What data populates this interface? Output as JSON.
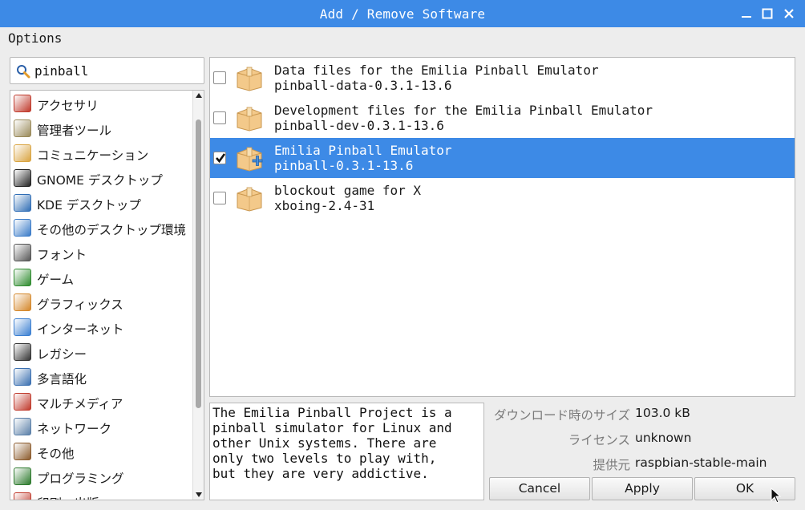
{
  "window": {
    "title": "Add / Remove Software"
  },
  "menu": {
    "options_label": "Options"
  },
  "search": {
    "value": "pinball"
  },
  "categories": [
    {
      "label": "アクセサリ",
      "icon": "accessories-icon",
      "color": "#c0392b"
    },
    {
      "label": "管理者ツール",
      "icon": "admin-tools-icon",
      "color": "#9a8a5a"
    },
    {
      "label": "コミュニケーション",
      "icon": "communication-icon",
      "color": "#d9a441"
    },
    {
      "label": "GNOME デスクトップ",
      "icon": "gnome-foot-icon",
      "color": "#222222"
    },
    {
      "label": "KDE デスクトップ",
      "icon": "kde-icon",
      "color": "#2f6db5"
    },
    {
      "label": "その他のデスクトップ環境",
      "icon": "desktop-icon",
      "color": "#3a7bc8"
    },
    {
      "label": "フォント",
      "icon": "font-icon",
      "color": "#555555"
    },
    {
      "label": "ゲーム",
      "icon": "game-invader-icon",
      "color": "#2e8b2e"
    },
    {
      "label": "グラフィックス",
      "icon": "graphics-brush-icon",
      "color": "#d4872a"
    },
    {
      "label": "インターネット",
      "icon": "globe-icon",
      "color": "#3b7fd1"
    },
    {
      "label": "レガシー",
      "icon": "floppy-icon",
      "color": "#333333"
    },
    {
      "label": "多言語化",
      "icon": "language-icon",
      "color": "#3a6fb0"
    },
    {
      "label": "マルチメディア",
      "icon": "multimedia-icon",
      "color": "#c0392b"
    },
    {
      "label": "ネットワーク",
      "icon": "network-icon",
      "color": "#5a7fa8"
    },
    {
      "label": "その他",
      "icon": "box-icon",
      "color": "#8b5a2b"
    },
    {
      "label": "プログラミング",
      "icon": "programming-icon",
      "color": "#2d7a2d"
    },
    {
      "label": "印刷・出版",
      "icon": "print-icon",
      "color": "#c0392b"
    }
  ],
  "packages": [
    {
      "name": "Data files for the Emilia Pinball Emulator",
      "version": "pinball-data-0.3.1-13.6",
      "checked": false,
      "selected": false
    },
    {
      "name": "Development files for the Emilia Pinball Emulator",
      "version": "pinball-dev-0.3.1-13.6",
      "checked": false,
      "selected": false
    },
    {
      "name": "Emilia Pinball Emulator",
      "version": "pinball-0.3.1-13.6",
      "checked": true,
      "selected": true
    },
    {
      "name": "blockout game for X",
      "version": "xboing-2.4-31",
      "checked": false,
      "selected": false
    }
  ],
  "description": "The Emilia Pinball Project is a\npinball simulator for Linux and\nother Unix systems. There are\nonly two levels to play with,\nbut they are very addictive.",
  "details": {
    "download_size_label": "ダウンロード時のサイズ",
    "download_size_value": "103.0 kB",
    "license_label": "ライセンス",
    "license_value": "unknown",
    "source_label": "提供元",
    "source_value": "raspbian-stable-main"
  },
  "buttons": {
    "cancel": "Cancel",
    "apply": "Apply",
    "ok": "OK"
  },
  "colors": {
    "accent": "#3d8ae6",
    "selection": "#3d8ae6"
  }
}
